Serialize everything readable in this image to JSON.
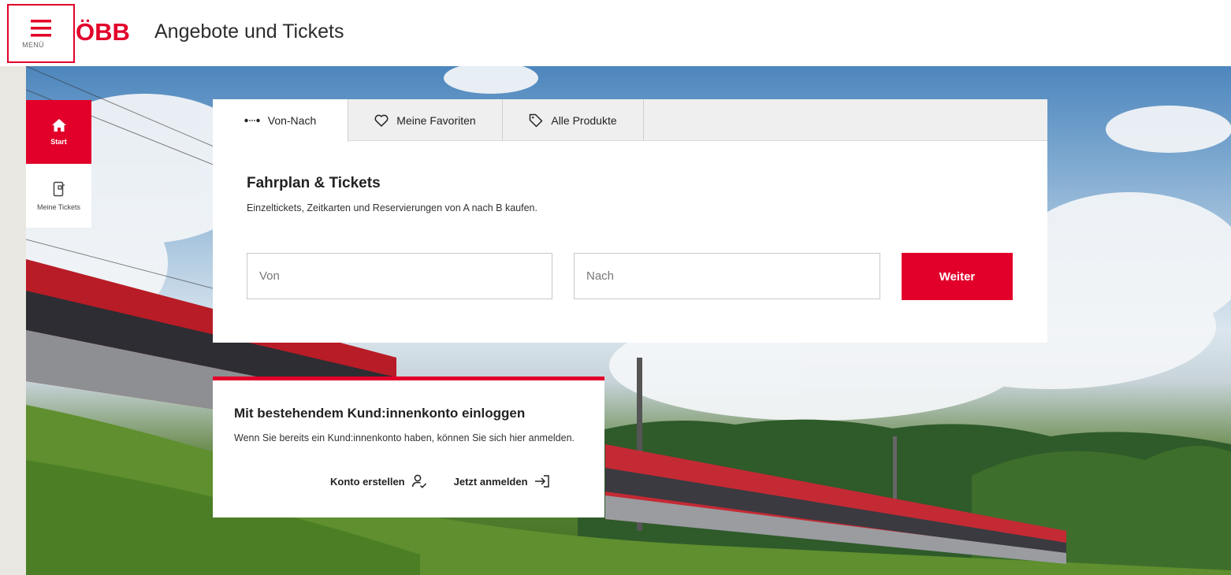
{
  "header": {
    "menu_label": "MENÜ",
    "logo_text": "ÖBB",
    "title": "Angebote und Tickets"
  },
  "sidenav": {
    "items": [
      {
        "label": "Start",
        "icon": "home-icon",
        "active": true
      },
      {
        "label": "Meine Tickets",
        "icon": "ticket-icon",
        "active": false
      }
    ]
  },
  "search": {
    "tabs": [
      {
        "label": "Von-Nach",
        "icon": "route-dots-icon",
        "active": true
      },
      {
        "label": "Meine Favoriten",
        "icon": "heart-icon",
        "active": false
      },
      {
        "label": "Alle Produkte",
        "icon": "tag-icon",
        "active": false
      }
    ],
    "title": "Fahrplan & Tickets",
    "subtitle": "Einzeltickets, Zeitkarten und Reservierungen von A nach B kaufen.",
    "from_placeholder": "Von",
    "to_placeholder": "Nach",
    "submit_label": "Weiter"
  },
  "login": {
    "title": "Mit bestehendem Kund:innenkonto einloggen",
    "text": "Wenn Sie bereits ein Kund:innenkonto haben, können Sie sich hier anmelden.",
    "create_label": "Konto erstellen",
    "login_label": "Jetzt anmelden"
  },
  "colors": {
    "brand_red": "#e2002a",
    "header_bg": "#ffffff",
    "tab_bg": "#efefef"
  }
}
